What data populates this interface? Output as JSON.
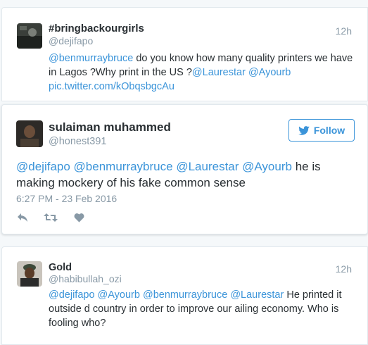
{
  "tweets": [
    {
      "name": "#bringbackourgirls",
      "handle": "@dejifapo",
      "time": "12h",
      "text_parts": [
        {
          "t": "@benmurraybruce",
          "link": true
        },
        {
          "t": " do you know how many quality printers we have in Lagos ?Why print in the US ?",
          "link": false
        },
        {
          "t": "@Laurestar",
          "link": true
        },
        {
          "t": " ",
          "link": false
        },
        {
          "t": "@Ayourb",
          "link": true
        },
        {
          "t": " ",
          "link": false
        },
        {
          "t": "pic.twitter.com/kObqsbgcAu",
          "link": true
        }
      ]
    },
    {
      "name": "sulaiman muhammed",
      "handle": "@honest391",
      "follow_label": "Follow",
      "date": "6:27 PM - 23 Feb 2016",
      "text_parts": [
        {
          "t": "@dejifapo",
          "link": true
        },
        {
          "t": " ",
          "link": false
        },
        {
          "t": "@benmurraybruce",
          "link": true
        },
        {
          "t": " ",
          "link": false
        },
        {
          "t": "@Laurestar",
          "link": true
        },
        {
          "t": " ",
          "link": false
        },
        {
          "t": "@Ayourb",
          "link": true
        },
        {
          "t": " he is making mockery of his fake common sense",
          "link": false
        }
      ],
      "actions": [
        "reply-icon",
        "retweet-icon",
        "like-icon"
      ]
    },
    {
      "name": "Gold",
      "handle": "@habibullah_ozi",
      "time": "12h",
      "text_parts": [
        {
          "t": "@dejifapo",
          "link": true
        },
        {
          "t": " ",
          "link": false
        },
        {
          "t": "@Ayourb",
          "link": true
        },
        {
          "t": " ",
          "link": false
        },
        {
          "t": "@benmurraybruce",
          "link": true
        },
        {
          "t": " ",
          "link": false
        },
        {
          "t": "@Laurestar",
          "link": true
        },
        {
          "t": " He printed it outside d country in order to improve our ailing economy. Who is fooling who?",
          "link": false
        }
      ]
    }
  ],
  "colors": {
    "link": "#3b94d9",
    "muted": "#8899a6",
    "text": "#292f33",
    "border": "#e1e8ed"
  }
}
